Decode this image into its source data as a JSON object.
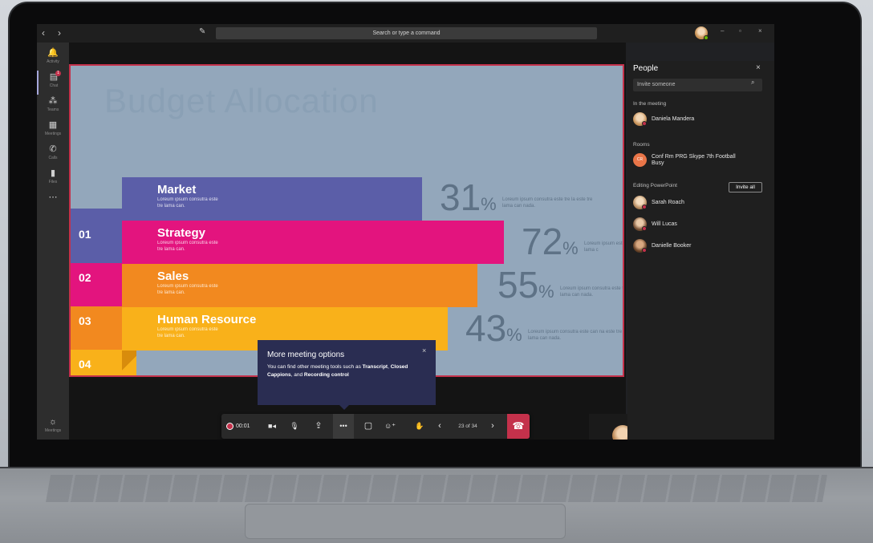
{
  "titlebar": {
    "back_glyph": "‹",
    "forward_glyph": "›",
    "search_placeholder": "Search or type a command",
    "compose_glyph": "✎",
    "window_controls": [
      "–",
      "▫",
      "×"
    ]
  },
  "rail": {
    "items": [
      {
        "label": "Activity",
        "icon": "bell-icon",
        "glyph": "🔔"
      },
      {
        "label": "Chat",
        "icon": "chat-icon",
        "glyph": "▤",
        "badge": "1"
      },
      {
        "label": "Teams",
        "icon": "teams-icon",
        "glyph": "⁂"
      },
      {
        "label": "Meetings",
        "icon": "calendar-icon",
        "glyph": "▦"
      },
      {
        "label": "Calls",
        "icon": "phone-icon",
        "glyph": "✆"
      },
      {
        "label": "Files",
        "icon": "file-icon",
        "glyph": "▮"
      },
      {
        "label": "",
        "icon": "more-apps-icon",
        "glyph": "⋯"
      }
    ],
    "help_label": "Meetings",
    "help_glyph": "☼"
  },
  "slide": {
    "title": "Budget Allocation",
    "rows": [
      {
        "number": "",
        "title": "Market",
        "desc": "Loreum ipsum consutra este tre lama can.",
        "percent": "31",
        "pct_desc": "Loreum ipsum consutra este tre la este tre lama can nada.",
        "color": "#5b5ea8"
      },
      {
        "number": "01",
        "title": "Strategy",
        "desc": "Loreum ipsum consutra este tre lama can.",
        "percent": "72",
        "pct_desc": "Loreum ipsum este tre lama c",
        "color": "#e3147e"
      },
      {
        "number": "02",
        "title": "Sales",
        "desc": "Loreum ipsum consutra este tre lama can.",
        "percent": "55",
        "pct_desc": "Loreum ipsum consutra este tre lama can nada.",
        "color": "#f2891f"
      },
      {
        "number": "03",
        "title": "Human Resource",
        "desc": "Loreum ipsum consutra este tre lama can.",
        "percent": "43",
        "pct_desc": "Loreum ipsum consutra este can na este tre lama can nada.",
        "color": "#f9b11a"
      }
    ],
    "last_number": "04",
    "percent_sign": "%"
  },
  "tooltip": {
    "title": "More meeting options",
    "body_prefix": "You can find other meeting tools such as ",
    "b1": "Transcript",
    "sep1": ", ",
    "b2": "Closed Cappions",
    "sep2": ", and ",
    "b3": "Recording control",
    "close": "×"
  },
  "controls": {
    "timer": "00:01",
    "camera": "■◂",
    "mic": "🎙",
    "share": "⇪",
    "more": "•••",
    "chat": "▢",
    "participants": "☺⁺",
    "raise_hand": "✋",
    "prev": "‹",
    "slide_counter": "23 of 34",
    "next": "›",
    "hangup": "☎"
  },
  "people": {
    "title": "People",
    "close": "×",
    "invite_placeholder": "Invite someone",
    "search_glyph": "⌕",
    "in_meeting_label": "In the meeting",
    "in_meeting": [
      {
        "name": "Daniela Mandera"
      }
    ],
    "rooms_label": "Rooms",
    "room": {
      "initials": "CR",
      "name": "Conf Rm PRG Skype 7th Football Busy"
    },
    "editing_label": "Editing PowerPoint",
    "invite_all": "Invite all",
    "editing": [
      {
        "name": "Sarah Roach"
      },
      {
        "name": "Will Lucas"
      },
      {
        "name": "Danielle Booker"
      }
    ]
  },
  "colors": {
    "accent": "#c4314b",
    "tooltip_bg": "#2a2d52",
    "slide_bg": "#93a7bb"
  }
}
